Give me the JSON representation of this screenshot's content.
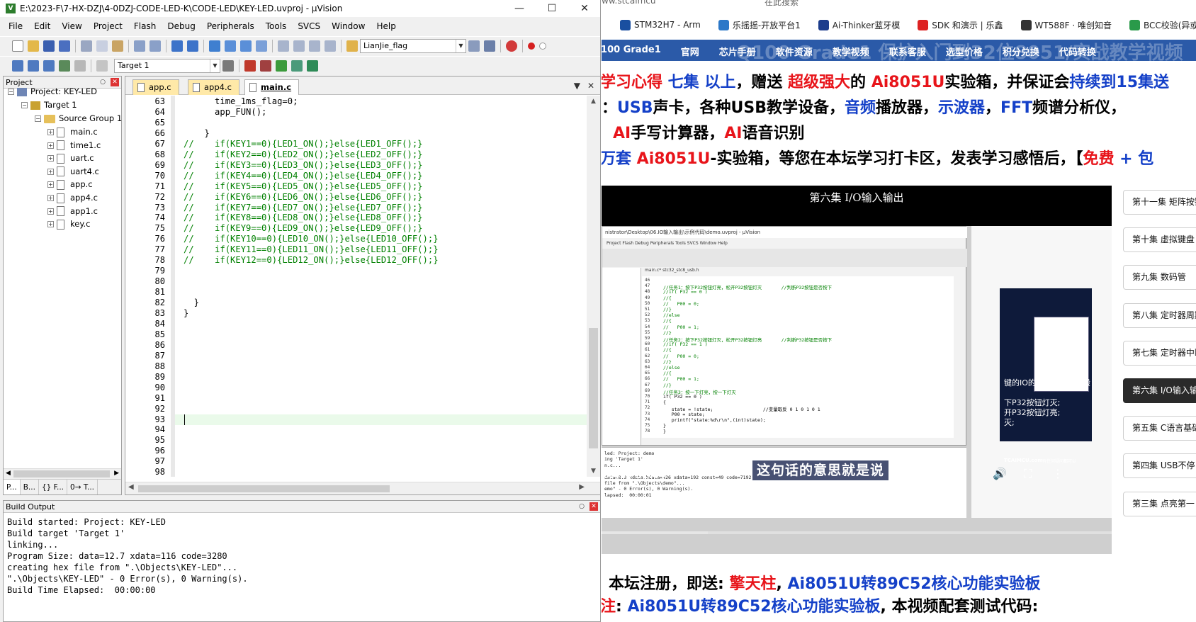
{
  "uvision": {
    "title": "E:\\2023-F\\7-HX-DZJ\\4-0DZJ-CODE-LED-K\\CODE-LED\\KEY-LED.uvproj - µVision",
    "menu": [
      "File",
      "Edit",
      "View",
      "Project",
      "Flash",
      "Debug",
      "Peripherals",
      "Tools",
      "SVCS",
      "Window",
      "Help"
    ],
    "toolbar": {
      "find_combo": "LianJie_flag",
      "target_combo": "Target 1"
    },
    "project_panel": {
      "header": "Project",
      "project": "Project: KEY-LED",
      "target": "Target 1",
      "group": "Source Group 1",
      "files": [
        "main.c",
        "time1.c",
        "uart.c",
        "uart4.c",
        "app.c",
        "app4.c",
        "app1.c",
        "key.c"
      ],
      "tabs": [
        "P...",
        "B...",
        "{} F...",
        "0→ T..."
      ]
    },
    "editor": {
      "tabs": [
        {
          "label": "app.c",
          "active": false
        },
        {
          "label": "app4.c",
          "active": false
        },
        {
          "label": "main.c",
          "active": true
        }
      ],
      "line_start": 63,
      "lines": [
        {
          "t": "      time_1ms_flag=0;",
          "c": false
        },
        {
          "t": "      app_FUN();",
          "c": false
        },
        {
          "t": "",
          "c": false
        },
        {
          "t": "    }",
          "c": false
        },
        {
          "t": "//    if(KEY1==0){LED1_ON();}else{LED1_OFF();}",
          "c": true
        },
        {
          "t": "//    if(KEY2==0){LED2_ON();}else{LED2_OFF();}",
          "c": true
        },
        {
          "t": "//    if(KEY3==0){LED3_ON();}else{LED3_OFF();}",
          "c": true
        },
        {
          "t": "//    if(KEY4==0){LED4_ON();}else{LED4_OFF();}",
          "c": true
        },
        {
          "t": "//    if(KEY5==0){LED5_ON();}else{LED5_OFF();}",
          "c": true
        },
        {
          "t": "//    if(KEY6==0){LED6_ON();}else{LED6_OFF();}",
          "c": true
        },
        {
          "t": "//    if(KEY7==0){LED7_ON();}else{LED7_OFF();}",
          "c": true
        },
        {
          "t": "//    if(KEY8==0){LED8_ON();}else{LED8_OFF();}",
          "c": true
        },
        {
          "t": "//    if(KEY9==0){LED9_ON();}else{LED9_OFF();}",
          "c": true
        },
        {
          "t": "//    if(KEY10==0){LED10_ON();}else{LED10_OFF();}",
          "c": true
        },
        {
          "t": "//    if(KEY11==0){LED11_ON();}else{LED11_OFF();}",
          "c": true
        },
        {
          "t": "//    if(KEY12==0){LED12_ON();}else{LED12_OFF();}",
          "c": true
        },
        {
          "t": "",
          "c": false
        },
        {
          "t": "",
          "c": false
        },
        {
          "t": "",
          "c": false
        },
        {
          "t": "  }",
          "c": false
        },
        {
          "t": "}",
          "c": false
        },
        {
          "t": "",
          "c": false
        },
        {
          "t": "",
          "c": false
        },
        {
          "t": "",
          "c": false
        },
        {
          "t": "",
          "c": false
        },
        {
          "t": "",
          "c": false
        },
        {
          "t": "",
          "c": false
        },
        {
          "t": "",
          "c": false
        },
        {
          "t": "",
          "c": false
        },
        {
          "t": "",
          "c": false
        },
        {
          "t": "",
          "c": false
        },
        {
          "t": "",
          "c": false
        },
        {
          "t": "",
          "c": false
        },
        {
          "t": "",
          "c": false
        },
        {
          "t": "",
          "c": false
        },
        {
          "t": "",
          "c": false
        }
      ],
      "current_line": 93
    },
    "build_output": {
      "header": "Build Output",
      "lines": [
        "Build started: Project: KEY-LED",
        "Build target 'Target 1'",
        "linking...",
        "Program Size: data=12.7 xdata=116 code=3280",
        "creating hex file from \".\\Objects\\KEY-LED\"...",
        "\".\\Objects\\KEY-LED\" - 0 Error(s), 0 Warning(s).",
        "Build Time Elapsed:  00:00:00"
      ]
    }
  },
  "browser": {
    "url_fragment": "ww.stcaimcu",
    "url_fragment2": "在此搜索",
    "bookmarks": [
      {
        "label": "STM32H7 - Arm",
        "color": "#1a4fa0"
      },
      {
        "label": "乐摇摇-开放平台1",
        "color": "#2c78c8"
      },
      {
        "label": "Ai-Thinker蓝牙模",
        "color": "#1d3d8c"
      },
      {
        "label": "SDK 和演示 | 乐鑫",
        "color": "#d22"
      },
      {
        "label": "WT588F · 唯创知音",
        "color": "#333"
      },
      {
        "label": "BCC校验(异或校验",
        "color": "#2a9a4a"
      }
    ],
    "site_nav": {
      "ghost_text": "Q100 Grade1 保护入门到32位8051/实战教学视频",
      "items": [
        "Q100 Grade1",
        "官网",
        "芯片手册",
        "软件资源",
        "教学视频",
        "联系客服",
        "选型价格",
        "积分兑换",
        "代码转换"
      ]
    },
    "promo": {
      "line1": [
        {
          "t": "学习心得 ",
          "k": "red"
        },
        {
          "t": "七集 以上",
          "k": "blue"
        },
        {
          "t": "，赠送 ",
          "k": "black"
        },
        {
          "t": "超级强大",
          "k": "red"
        },
        {
          "t": "的 ",
          "k": "black"
        },
        {
          "t": "Ai8051U",
          "k": "red"
        },
        {
          "t": "实验箱，并保证会",
          "k": "black"
        },
        {
          "t": "持续到15集送",
          "k": "blue"
        }
      ],
      "line2": [
        {
          "t": "：",
          "k": "black"
        },
        {
          "t": "USB",
          "k": "blue"
        },
        {
          "t": "声卡，各种USB教学设备，",
          "k": "black"
        },
        {
          "t": "音频",
          "k": "blue"
        },
        {
          "t": "播放器，",
          "k": "black"
        },
        {
          "t": "示波器",
          "k": "blue"
        },
        {
          "t": "，",
          "k": "black"
        },
        {
          "t": "FFT",
          "k": "blue"
        },
        {
          "t": "频谱分析仪，",
          "k": "black"
        }
      ],
      "line3": [
        {
          "t": "AI",
          "k": "red"
        },
        {
          "t": "手写计算器，",
          "k": "black"
        },
        {
          "t": "AI",
          "k": "red"
        },
        {
          "t": "语音识别",
          "k": "black"
        }
      ],
      "line4": [
        {
          "t": "万套 ",
          "k": "blue"
        },
        {
          "t": "Ai8051U",
          "k": "red"
        },
        {
          "t": "-实验箱，等您在本坛学习打卡区，发表学习感悟后，【",
          "k": "black"
        },
        {
          "t": "免费",
          "k": "red"
        },
        {
          "t": " + 包",
          "k": "blue"
        }
      ],
      "bottom1": [
        {
          "t": "本坛注册，即送: ",
          "k": "black"
        },
        {
          "t": "擎天柱",
          "k": "red"
        },
        {
          "t": ", ",
          "k": "black"
        },
        {
          "t": "Ai8051U转89C52核心功能实验板",
          "k": "blue"
        }
      ],
      "bottom2": [
        {
          "t": "注",
          "k": "red"
        },
        {
          "t": ": ",
          "k": "black"
        },
        {
          "t": "Ai8051U转89C52核心功能实验板",
          "k": "blue"
        },
        {
          "t": ", 本视频配套测试代码:",
          "k": "black"
        }
      ]
    },
    "video": {
      "title": "第六集 I/O输入输出",
      "subtitle": "这句话的意思就是说",
      "time": "6:49 / 32:44",
      "progress": 0.208,
      "inner": {
        "title": "nistrator\\Desktop\\06.IO输入输出\\示例代码\\demo.uvproj - µVision",
        "menu": "Project   Flash   Debug   Peripherals   Tools   SVCS   Window   Help",
        "tabs": "main.c*    stc32_stc8_usb.h",
        "code": [
          {
            "n": "46",
            "t": "",
            "b": false
          },
          {
            "n": "47",
            "t": "//任务1：按下P32按钮灯亮，松开P32按钮灯灭       //判断P32按钮是否按下",
            "b": false
          },
          {
            "n": "48",
            "t": "//if( P32 == 0 )",
            "b": false
          },
          {
            "n": "49",
            "t": "//{",
            "b": false
          },
          {
            "n": "50",
            "t": "//   P00 = 0;",
            "b": false
          },
          {
            "n": "51",
            "t": "//}",
            "b": false
          },
          {
            "n": "52",
            "t": "//else",
            "b": false
          },
          {
            "n": "53",
            "t": "//{",
            "b": false
          },
          {
            "n": "54",
            "t": "//   P00 = 1;",
            "b": false
          },
          {
            "n": "55",
            "t": "//}",
            "b": false
          },
          {
            "n": "59",
            "t": "//任务2：按下P32按钮灯灭，松开P32按钮灯亮       //判断P32按钮是否按下",
            "b": false
          },
          {
            "n": "60",
            "t": "//if( P32 == 1 )",
            "b": false
          },
          {
            "n": "61",
            "t": "//{",
            "b": false
          },
          {
            "n": "62",
            "t": "//   P00 = 0;",
            "b": false
          },
          {
            "n": "63",
            "t": "//}",
            "b": false
          },
          {
            "n": "64",
            "t": "//else",
            "b": false
          },
          {
            "n": "65",
            "t": "//{",
            "b": false
          },
          {
            "n": "66",
            "t": "//   P00 = 1;",
            "b": false
          },
          {
            "n": "67",
            "t": "//}",
            "b": false
          },
          {
            "n": "69",
            "t": "//任务3：按一下灯亮，按一下灯灭",
            "b": false
          },
          {
            "n": "70",
            "t": "if( P32 == 0 )",
            "b": true
          },
          {
            "n": "71",
            "t": "{",
            "b": true
          },
          {
            "n": "72",
            "t": "   state = !state;                  //变量取反 0 1 0 1 0 1",
            "b": true
          },
          {
            "n": "73",
            "t": "   P00 = state;",
            "b": true
          },
          {
            "n": "74",
            "t": "   printf(\"state:%d\\r\\n\",(int)state);",
            "b": true
          },
          {
            "n": "75",
            "t": "}",
            "b": true
          },
          {
            "n": "78",
            "t": "}",
            "b": true
          }
        ],
        "build": [
          "led: Project: demo",
          "ing 'Target 1'",
          "n.c...",
          "",
          "data=8.3 xdata+hdata=426 xdata=192 const=49 code=7192",
          "file from \".\\Objects\\demo\"...",
          "emo\" - 0 Error(s), 0 Warning(s).",
          "lapsed:  00:00:01"
        ],
        "overlay_lines": [
          "键的IO的电平即可，一般",
          "下P32按钮灯灭;",
          "开P32按钮灯亮;",
          "灭;"
        ],
        "brand": "TCAIMCU.com",
        "brand_note": "有任何疑问都可以"
      }
    },
    "episodes": [
      {
        "label": "第十一集 矩阵按键",
        "active": false
      },
      {
        "label": "第十集 虚拟键盘",
        "active": false
      },
      {
        "label": "第九集 数码管",
        "active": false
      },
      {
        "label": "第八集 定时器周期",
        "active": false
      },
      {
        "label": "第七集 定时器中断",
        "active": false
      },
      {
        "label": "第六集 I/O输入输出",
        "active": true
      },
      {
        "label": "第五集 C语言基础",
        "active": false
      },
      {
        "label": "第四集 USB不停电",
        "active": false
      },
      {
        "label": "第三集 点亮第一",
        "active": false
      }
    ]
  }
}
